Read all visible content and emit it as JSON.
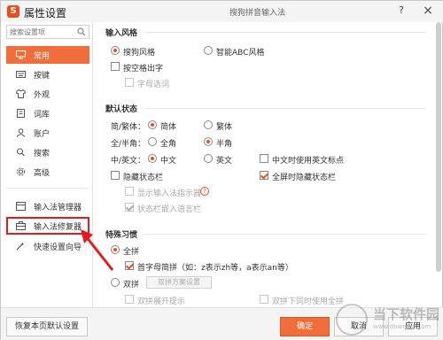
{
  "app": {
    "logo_char": "S",
    "title": "属性设置",
    "window_title": "搜狗拼音输入法",
    "help": "?",
    "close": "×"
  },
  "sidebar": {
    "search_placeholder": "搜索设置项",
    "items": [
      {
        "label": "常用",
        "icon": "monitor-icon",
        "active": true
      },
      {
        "label": "按键",
        "icon": "keyboard-icon"
      },
      {
        "label": "外观",
        "icon": "shirt-icon"
      },
      {
        "label": "词库",
        "icon": "book-icon"
      },
      {
        "label": "账户",
        "icon": "user-icon"
      },
      {
        "label": "搜索",
        "icon": "search-icon"
      },
      {
        "label": "高级",
        "icon": "gear-icon"
      },
      {
        "label": "输入法管理器",
        "icon": "manager-icon"
      },
      {
        "label": "输入法修复器",
        "icon": "toolbox-icon",
        "highlighted": true
      },
      {
        "label": "快速设置向导",
        "icon": "wizard-icon"
      }
    ]
  },
  "main": {
    "section_input_style": {
      "title": "输入风格",
      "option_sogou": "搜狗风格",
      "option_abc": "智能ABC风格",
      "selected": "搜狗风格",
      "space_output": "按空格出字",
      "space_output_checked": false,
      "letter_select": "字母选词",
      "letter_select_checked": false
    },
    "section_default_state": {
      "title": "默认状态",
      "row1_label": "简/繁体：",
      "row1_opt1": "简体",
      "row1_opt2": "繁体",
      "row1_selected": "简体",
      "row2_label": "全/半角：",
      "row2_opt1": "全角",
      "row2_opt2": "半角",
      "row2_selected": "半角",
      "row3_label": "中/英文：",
      "row3_opt1": "中文",
      "row3_opt2": "英文",
      "row3_selected": "中文",
      "chinese_english_punct": "中文时使用英文标点",
      "chinese_english_punct_checked": false,
      "hide_statusbar": "隐藏状态栏",
      "hide_statusbar_checked": false,
      "fullscreen_hide_statusbar": "全屏时隐藏状态栏",
      "fullscreen_hide_statusbar_checked": true,
      "show_indicator": "显示输入法指示器",
      "show_indicator_checked": false,
      "help_mark": "?",
      "embed_language_bar": "状态栏嵌入语言栏",
      "embed_language_bar_checked": true
    },
    "section_special_habits": {
      "title": "特殊习惯",
      "full_pinyin": "全拼",
      "full_pinyin_selected": true,
      "initial_abbrev": "首字母简拼（如：z表示zh等，a表示an等）",
      "initial_abbrev_checked": true,
      "double_pinyin": "双拼",
      "double_pinyin_selected": false,
      "double_scheme_button": "双拼方案设置",
      "double_expand_hint": "双拼展开提示",
      "double_expand_hint_checked": false,
      "double_with_full": "双拼下同时使用全拼",
      "double_with_full_checked": false
    }
  },
  "footer": {
    "restore_default": "恢复本页默认设置",
    "ok": "确定",
    "cancel": "取消",
    "apply": "应用"
  },
  "watermark": {
    "text": "当下软件园",
    "url": "www.downxia.com"
  },
  "colors": {
    "accent": "#f06e3c",
    "highlight_border": "#e31c1c"
  }
}
